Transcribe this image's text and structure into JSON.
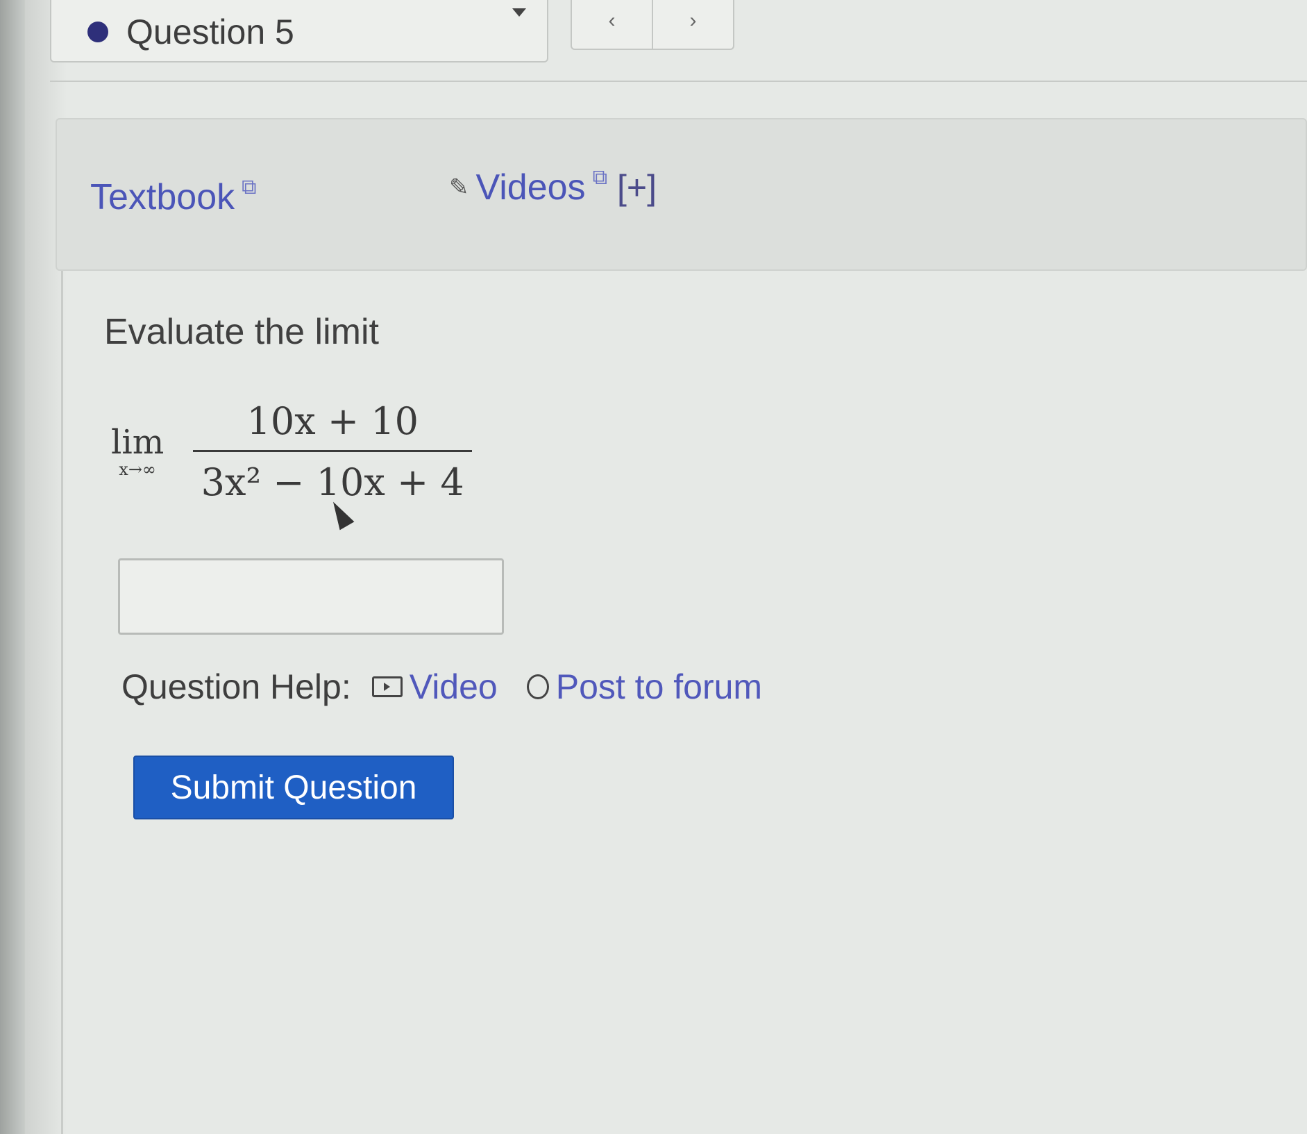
{
  "question_nav": {
    "selected": "Question 5",
    "status_color": "#2e2f7a",
    "prev_icon": "chevron-left",
    "next_icon": "chevron-right"
  },
  "help_links": {
    "textbook_label": "Textbook",
    "videos_label": "Videos",
    "expand_label": "[+]"
  },
  "question": {
    "prompt": "Evaluate the limit",
    "limit_word": "lim",
    "limit_subscript": "x→∞",
    "numerator": "10x + 10",
    "denominator": "3x² − 10x + 4"
  },
  "answer": {
    "value": "",
    "placeholder": ""
  },
  "question_help": {
    "label": "Question Help:",
    "video_label": "Video",
    "forum_label": "Post to forum"
  },
  "submit": {
    "label": "Submit Question",
    "color": "#1f5fc4"
  }
}
